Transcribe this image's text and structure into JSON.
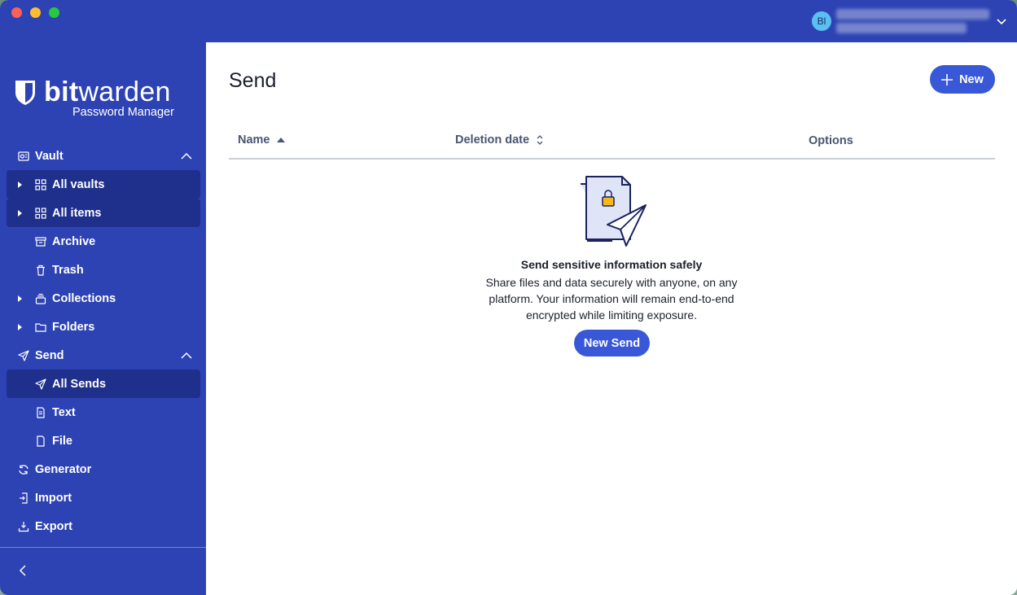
{
  "account": {
    "initials": "Bl"
  },
  "sidebar": {
    "logo_word_bold": "bit",
    "logo_word_rest": "warden",
    "logo_subtitle": "Password Manager",
    "items": [
      {
        "label": "Vault",
        "icon": "vault-icon",
        "expanded": true
      },
      {
        "label": "All vaults",
        "icon": "grid-icon",
        "expanded": false
      },
      {
        "label": "All items",
        "icon": "grid-icon",
        "expanded": false
      },
      {
        "label": "Archive",
        "icon": "archive-icon"
      },
      {
        "label": "Trash",
        "icon": "trash-icon"
      },
      {
        "label": "Collections",
        "icon": "collections-icon",
        "expanded": false
      },
      {
        "label": "Folders",
        "icon": "folder-icon",
        "expanded": false
      },
      {
        "label": "Send",
        "icon": "paper-plane-icon",
        "expanded": true
      },
      {
        "label": "All Sends",
        "icon": "paper-plane-icon",
        "active": true
      },
      {
        "label": "Text",
        "icon": "file-text-icon"
      },
      {
        "label": "File",
        "icon": "file-icon"
      },
      {
        "label": "Generator",
        "icon": "generator-icon"
      },
      {
        "label": "Import",
        "icon": "import-icon"
      },
      {
        "label": "Export",
        "icon": "export-icon"
      }
    ]
  },
  "main": {
    "title": "Send",
    "new_button": "New",
    "columns": {
      "name": "Name",
      "deletion_date": "Deletion date",
      "options": "Options"
    },
    "empty": {
      "title": "Send sensitive information safely",
      "body_line1": "Share files and data securely with anyone, on any",
      "body_line2": "platform. Your information will remain end-to-end",
      "body_line3": "encrypted while limiting exposure.",
      "button": "New Send"
    }
  },
  "colors": {
    "sidebar": "#2e43b3",
    "sidebar_active": "#1f2f8c",
    "primary_button": "#3958d8"
  }
}
